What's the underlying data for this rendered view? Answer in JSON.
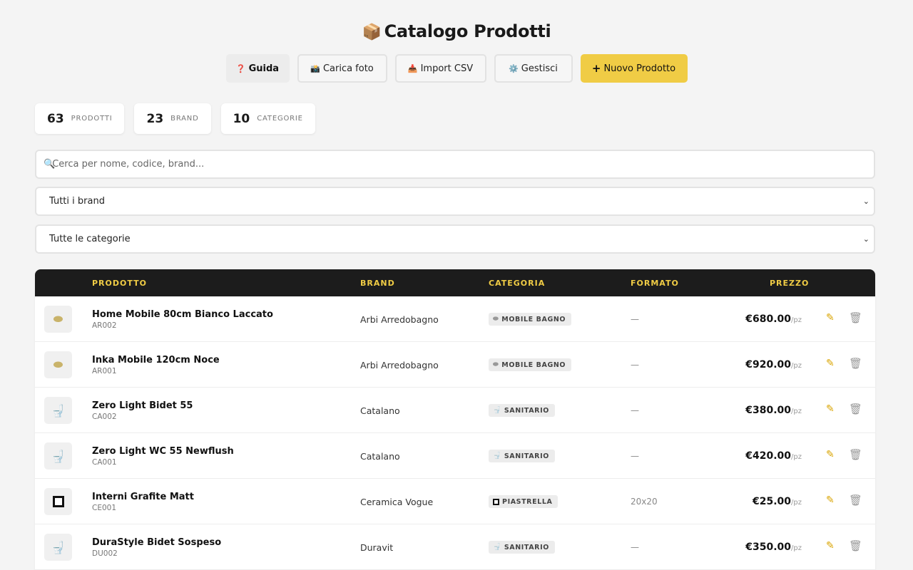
{
  "header": {
    "emoji": "📦",
    "title": "Catalogo Prodotti"
  },
  "toolbar": {
    "guida": {
      "icon": "❓",
      "label": "Guida"
    },
    "carica": {
      "icon": "📸",
      "label": "Carica foto"
    },
    "import": {
      "icon": "📥",
      "label": "Import CSV"
    },
    "gestisci": {
      "icon": "⚙️",
      "label": "Gestisci"
    },
    "nuovo": {
      "icon": "+",
      "label": "Nuovo Prodotto"
    }
  },
  "stats": [
    {
      "value": "63",
      "label": "PRODOTTI"
    },
    {
      "value": "23",
      "label": "BRAND"
    },
    {
      "value": "10",
      "label": "CATEGORIE"
    }
  ],
  "search": {
    "icon": "🔍",
    "placeholder": "Cerca per nome, codice, brand..."
  },
  "filters": {
    "brand": "Tutti i brand",
    "category": "Tutte le categorie"
  },
  "table": {
    "headers": {
      "product": "PRODOTTO",
      "brand": "BRAND",
      "category": "CATEGORIA",
      "format": "FORMATO",
      "price": "PREZZO"
    },
    "rows": [
      {
        "name": "Home Mobile 80cm Bianco Laccato",
        "code": "AR002",
        "brand": "Arbi Arredobagno",
        "category": "MOBILE BAGNO",
        "category_icon": "mirror-icon",
        "format": "—",
        "price": "€680.00",
        "unit": "/pz"
      },
      {
        "name": "Inka Mobile 120cm Noce",
        "code": "AR001",
        "brand": "Arbi Arredobagno",
        "category": "MOBILE BAGNO",
        "category_icon": "mirror-icon",
        "format": "—",
        "price": "€920.00",
        "unit": "/pz"
      },
      {
        "name": "Zero Light Bidet 55",
        "code": "CA002",
        "brand": "Catalano",
        "category": "SANITARIO",
        "category_icon": "toilet-icon",
        "format": "—",
        "price": "€380.00",
        "unit": "/pz"
      },
      {
        "name": "Zero Light WC 55 Newflush",
        "code": "CA001",
        "brand": "Catalano",
        "category": "SANITARIO",
        "category_icon": "toilet-icon",
        "format": "—",
        "price": "€420.00",
        "unit": "/pz"
      },
      {
        "name": "Interni Grafite Matt",
        "code": "CE001",
        "brand": "Ceramica Vogue",
        "category": "PIASTRELLA",
        "category_icon": "tile-icon",
        "format": "20x20",
        "price": "€25.00",
        "unit": "/pz"
      },
      {
        "name": "DuraStyle Bidet Sospeso",
        "code": "DU002",
        "brand": "Duravit",
        "category": "SANITARIO",
        "category_icon": "toilet-icon",
        "format": "—",
        "price": "€350.00",
        "unit": "/pz"
      }
    ]
  }
}
